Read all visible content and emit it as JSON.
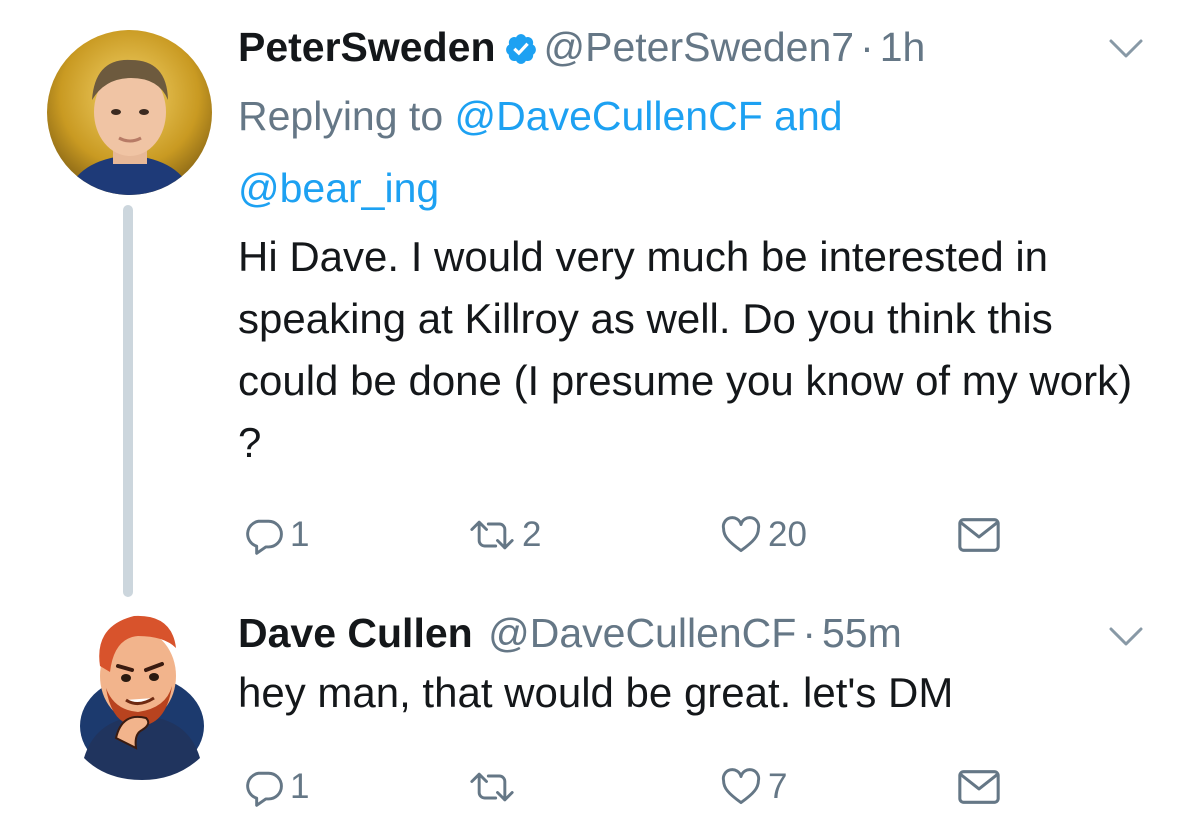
{
  "tweets": [
    {
      "display_name": "PeterSweden",
      "handle": "@PeterSweden7",
      "separator": "·",
      "time": "1h",
      "replying_prefix": "Replying to",
      "reply_to_1": "@DaveCullenCF",
      "reply_and": "and",
      "reply_to_2": "@bear_ing",
      "text": "Hi Dave. I would very much be interested in speaking at Killroy as well. Do you think this could be done (I presume you know of my work) ?",
      "replies": "1",
      "retweets": "2",
      "likes": "20",
      "verified": true,
      "icons": [
        "verified-badge-icon",
        "chevron-down-icon",
        "reply-icon",
        "retweet-icon",
        "like-icon",
        "dm-icon"
      ]
    },
    {
      "display_name": "Dave Cullen",
      "handle": "@DaveCullenCF",
      "separator": "·",
      "time": "55m",
      "text": "hey man, that would be great. let's DM",
      "replies": "1",
      "retweets": "",
      "likes": "7",
      "verified": false,
      "icons": [
        "chevron-down-icon",
        "reply-icon",
        "retweet-icon",
        "like-icon",
        "dm-icon"
      ]
    }
  ],
  "colors": {
    "link": "#1da1f2",
    "secondary_text": "#657786",
    "primary_text": "#14171a",
    "thread_line": "#ccd6dd"
  }
}
